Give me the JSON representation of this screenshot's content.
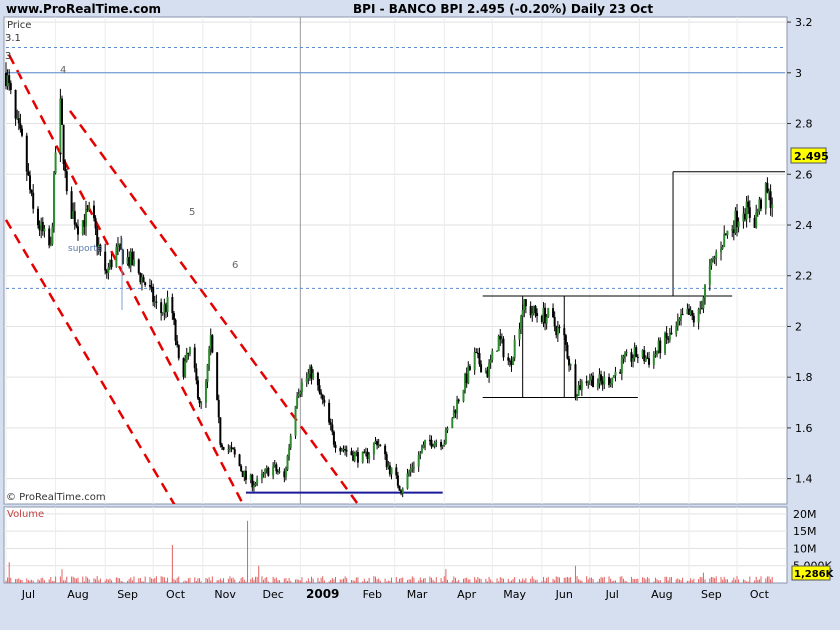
{
  "header": {
    "site": "www.ProRealTime.com",
    "title": "BPI - BANCO BPI    2.495 (-0.20%)    Daily  23 Oct"
  },
  "price_panel": {
    "label": "Price",
    "copyright": "© ProRealTime.com",
    "current_price": "2.495",
    "annotations": [
      "3.1",
      "3",
      "4",
      "5",
      "6",
      "suporte"
    ]
  },
  "volume_panel": {
    "label": "Volume",
    "current_volume": "1,286K"
  },
  "colors": {
    "up": "#2e8b2e",
    "down": "#000000",
    "channel": "#e60000",
    "support": "#1a1a99",
    "volume": "#e06060",
    "plot_bg": "#ffffff",
    "frame_bg": "#d6dff0",
    "price_tag": "#ffff00"
  },
  "chart_data": {
    "type": "candlestick",
    "price_axis": {
      "ticks": [
        "1.4",
        "1.6",
        "1.8",
        "2",
        "2.2",
        "2.4",
        "2.6",
        "2.8",
        "3",
        "3.2"
      ],
      "range": [
        1.3,
        3.22
      ]
    },
    "volume_axis": {
      "ticks": [
        "5,000K",
        "10M",
        "15M",
        "20M"
      ],
      "range": [
        0,
        22000000
      ]
    },
    "x_axis": {
      "labels": [
        "Jul",
        "Aug",
        "Sep",
        "Oct",
        "Nov",
        "Dec",
        "2009",
        "Feb",
        "Mar",
        "Apr",
        "May",
        "Jun",
        "Jul",
        "Aug",
        "Sep",
        "Oct"
      ],
      "range": [
        "2008-07-01",
        "2009-10-31"
      ]
    },
    "price_path": [
      [
        "2008-07-01",
        3.0
      ],
      [
        "2008-07-07",
        2.8
      ],
      [
        "2008-07-12",
        2.7
      ],
      [
        "2008-07-18",
        2.45
      ],
      [
        "2008-07-25",
        2.35
      ],
      [
        "2008-07-29",
        2.3
      ],
      [
        "2008-08-03",
        2.95
      ],
      [
        "2008-08-08",
        2.5
      ],
      [
        "2008-08-15",
        2.4
      ],
      [
        "2008-08-23",
        2.45
      ],
      [
        "2008-09-01",
        2.2
      ],
      [
        "2008-09-08",
        2.3
      ],
      [
        "2008-09-18",
        2.25
      ],
      [
        "2008-09-28",
        2.15
      ],
      [
        "2008-10-05",
        2.05
      ],
      [
        "2008-10-12",
        2.1
      ],
      [
        "2008-10-18",
        1.8
      ],
      [
        "2008-10-24",
        1.9
      ],
      [
        "2008-11-01",
        1.65
      ],
      [
        "2008-11-06",
        1.95
      ],
      [
        "2008-11-12",
        1.55
      ],
      [
        "2008-11-20",
        1.5
      ],
      [
        "2008-11-28",
        1.4
      ],
      [
        "2008-12-05",
        1.38
      ],
      [
        "2008-12-14",
        1.45
      ],
      [
        "2008-12-22",
        1.4
      ],
      [
        "2008-12-30",
        1.75
      ],
      [
        "2009-01-08",
        1.82
      ],
      [
        "2009-01-15",
        1.7
      ],
      [
        "2009-01-22",
        1.55
      ],
      [
        "2009-02-01",
        1.5
      ],
      [
        "2009-02-10",
        1.48
      ],
      [
        "2009-02-18",
        1.55
      ],
      [
        "2009-02-25",
        1.45
      ],
      [
        "2009-03-05",
        1.36
      ],
      [
        "2009-03-12",
        1.45
      ],
      [
        "2009-03-22",
        1.55
      ],
      [
        "2009-04-01",
        1.55
      ],
      [
        "2009-04-10",
        1.72
      ],
      [
        "2009-04-20",
        1.88
      ],
      [
        "2009-04-28",
        1.82
      ],
      [
        "2009-05-05",
        1.95
      ],
      [
        "2009-05-12",
        1.85
      ],
      [
        "2009-05-20",
        2.08
      ],
      [
        "2009-05-28",
        2.05
      ],
      [
        "2009-06-05",
        2.04
      ],
      [
        "2009-06-15",
        1.95
      ],
      [
        "2009-06-22",
        1.75
      ],
      [
        "2009-06-30",
        1.8
      ],
      [
        "2009-07-08",
        1.78
      ],
      [
        "2009-07-15",
        1.8
      ],
      [
        "2009-07-22",
        1.86
      ],
      [
        "2009-07-30",
        1.89
      ],
      [
        "2009-08-08",
        1.87
      ],
      [
        "2009-08-15",
        1.93
      ],
      [
        "2009-08-22",
        1.97
      ],
      [
        "2009-08-30",
        2.05
      ],
      [
        "2009-09-06",
        2.02
      ],
      [
        "2009-09-13",
        2.2
      ],
      [
        "2009-09-20",
        2.32
      ],
      [
        "2009-09-28",
        2.4
      ],
      [
        "2009-10-05",
        2.47
      ],
      [
        "2009-10-12",
        2.42
      ],
      [
        "2009-10-18",
        2.53
      ],
      [
        "2009-10-23",
        2.495
      ]
    ],
    "trendlines": [
      {
        "style": "channel",
        "from": [
          "2008-07-03",
          3.07
        ],
        "to": [
          "2008-12-06",
          1.18
        ]
      },
      {
        "style": "channel",
        "from": [
          "2008-07-01",
          2.42
        ],
        "to": [
          "2008-11-30",
          0.8
        ]
      },
      {
        "style": "channel",
        "from": [
          "2008-08-10",
          2.85
        ],
        "to": [
          "2009-04-05",
          0.8
        ]
      },
      {
        "style": "support",
        "from": [
          "2008-11-28",
          1.345
        ],
        "to": [
          "2009-03-31",
          1.345
        ]
      },
      {
        "style": "pattern",
        "from": [
          "2009-04-25",
          2.12
        ],
        "to": [
          "2009-09-28",
          2.12
        ]
      },
      {
        "style": "pattern",
        "from": [
          "2009-04-25",
          1.72
        ],
        "to": [
          "2009-07-31",
          1.72
        ]
      },
      {
        "style": "pattern",
        "from": [
          "2009-05-20",
          2.12
        ],
        "to": [
          "2009-05-20",
          1.72
        ]
      },
      {
        "style": "pattern",
        "from": [
          "2009-06-15",
          2.12
        ],
        "to": [
          "2009-06-15",
          1.72
        ]
      },
      {
        "style": "pattern",
        "from": [
          "2009-08-22",
          2.61
        ],
        "to": [
          "2009-10-31",
          2.61
        ]
      },
      {
        "style": "pattern",
        "from": [
          "2009-08-22",
          2.61
        ],
        "to": [
          "2009-08-22",
          2.12
        ]
      },
      {
        "style": "support-dash",
        "from": [
          "2008-07-01",
          2.15
        ],
        "to": [
          "2009-10-31",
          2.15
        ]
      },
      {
        "style": "blue-h",
        "from": [
          "2008-07-01",
          3.0
        ],
        "to": [
          "2009-10-31",
          3.0
        ]
      },
      {
        "style": "blue-dash",
        "from": [
          "2008-07-01",
          3.1
        ],
        "to": [
          "2009-10-31",
          3.1
        ]
      }
    ],
    "volume_spikes": [
      [
        "2008-07-03",
        6000000
      ],
      [
        "2008-08-05",
        4000000
      ],
      [
        "2008-10-13",
        11000000
      ],
      [
        "2008-11-29",
        18000000
      ],
      [
        "2008-12-06",
        5000000
      ],
      [
        "2009-04-02",
        4000000
      ],
      [
        "2009-06-22",
        5000000
      ],
      [
        "2009-09-10",
        3000000
      ]
    ]
  }
}
